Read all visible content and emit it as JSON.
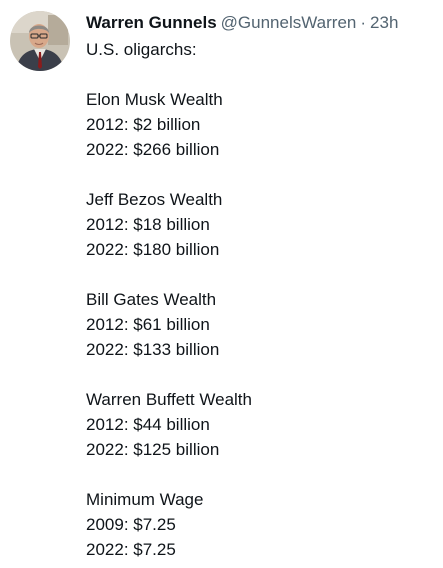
{
  "tweet": {
    "author_name": "Warren Gunnels",
    "author_handle": "@GunnelsWarren",
    "separator": "·",
    "timestamp": "23h",
    "intro": "U.S. oligarchs:",
    "sections": [
      {
        "heading": "Elon Musk Wealth",
        "lines": [
          "2012: $2 billion",
          "2022: $266 billion"
        ]
      },
      {
        "heading": "Jeff Bezos Wealth",
        "lines": [
          "2012: $18 billion",
          "2022: $180 billion"
        ]
      },
      {
        "heading": "Bill Gates Wealth",
        "lines": [
          "2012: $61 billion",
          "2022: $133 billion"
        ]
      },
      {
        "heading": "Warren Buffett Wealth",
        "lines": [
          "2012: $44 billion",
          "2022: $125 billion"
        ]
      },
      {
        "heading": "Minimum Wage",
        "lines": [
          "2009: $7.25",
          "2022: $7.25"
        ]
      }
    ]
  },
  "icons": {
    "avatar": "profile-photo"
  },
  "colors": {
    "text_primary": "#0f1419",
    "text_secondary": "#536471"
  }
}
